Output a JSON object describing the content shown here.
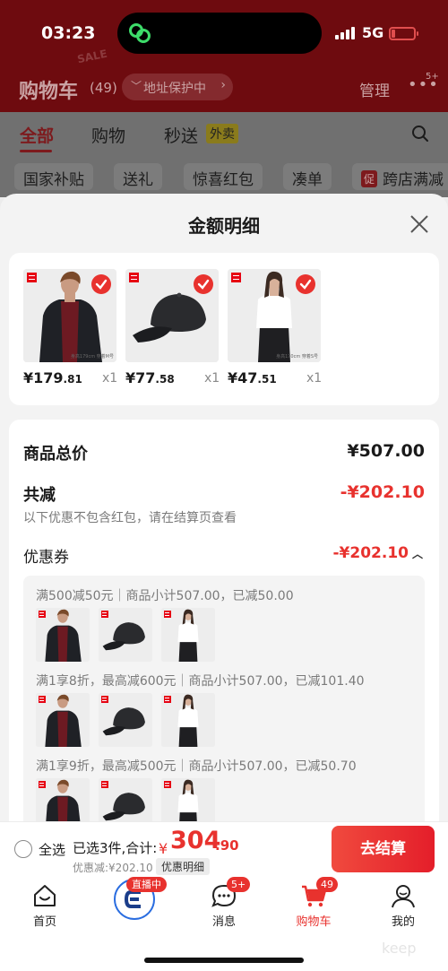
{
  "status_bar": {
    "time": "03:23",
    "network": "5G"
  },
  "background": {
    "title": "购物车",
    "count": "(49)",
    "stamp": "SALE",
    "address_pill": "地址保护中",
    "manage": "管理",
    "more_badge": "5+",
    "tabs": [
      {
        "label": "全部",
        "active": true
      },
      {
        "label": "购物",
        "active": false
      },
      {
        "label": "秒送",
        "active": false
      }
    ],
    "waimai_badge": "外卖",
    "filters": [
      "国家补贴",
      "送礼",
      "惊喜红包",
      "凑单",
      "跨店满减"
    ],
    "filter_tag": "促"
  },
  "sheet": {
    "title": "金额明细",
    "products": [
      {
        "price_int": "¥179",
        "price_dec": ".81",
        "qty": "x1",
        "name": "jacket-product",
        "cap": "身高179cm\n穿着M号"
      },
      {
        "price_int": "¥77",
        "price_dec": ".58",
        "qty": "x1",
        "name": "cap-product",
        "cap": ""
      },
      {
        "price_int": "¥47",
        "price_dec": ".51",
        "qty": "x1",
        "name": "tshirt-product",
        "cap": "身高170cm\n穿着S号"
      }
    ],
    "total_label": "商品总价",
    "total_value": "¥507.00",
    "reduce_label": "共减",
    "reduce_value": "-¥202.10",
    "hint": "以下优惠不包含红包，请在结算页查看",
    "coupon_label": "优惠券",
    "coupon_value": "-¥202.10",
    "coupon_lines": [
      "满500减50元｜商品小计507.00，已减50.00",
      "满1享8折，最高减600元｜商品小计507.00，已减101.40",
      "满1享9折，最高减500元｜商品小计507.00，已减50.70"
    ]
  },
  "bottom_bar": {
    "select_all": "全选",
    "selected": "已选3件,合计:",
    "currency": "¥",
    "total_int": "304",
    "total_dec": ".90",
    "discount": "优惠减:¥202.10",
    "detail_pill": "优惠明细",
    "checkout": "去结算"
  },
  "tabbar": {
    "items": [
      "首页",
      "",
      "消息",
      "购物车",
      "我的"
    ],
    "live_badge": "直播中",
    "msg_badge": "5+",
    "cart_badge": "49",
    "accent": "#e8322e"
  },
  "watermark": "keep"
}
